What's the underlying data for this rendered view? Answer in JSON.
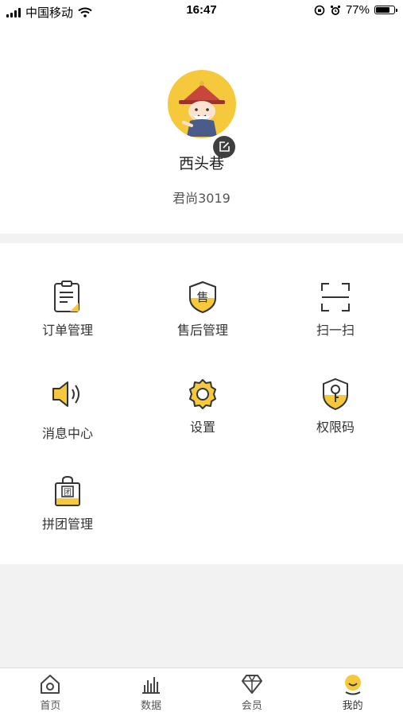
{
  "status_bar": {
    "carrier": "中国移动",
    "time": "16:47",
    "battery": "77%",
    "battery_level": 0.77
  },
  "profile": {
    "name": "西头巷",
    "shop": "君尚3019"
  },
  "menu": {
    "items": [
      {
        "label": "订单管理",
        "icon": "order-icon"
      },
      {
        "label": "售后管理",
        "icon": "after-sales-icon"
      },
      {
        "label": "扫一扫",
        "icon": "scan-icon"
      },
      {
        "label": "消息中心",
        "icon": "speaker-icon"
      },
      {
        "label": "设置",
        "icon": "gear-icon"
      },
      {
        "label": "权限码",
        "icon": "permission-key-icon"
      },
      {
        "label": "拼团管理",
        "icon": "group-buy-bag-icon"
      }
    ]
  },
  "tab_bar": {
    "tabs": [
      {
        "label": "首页",
        "icon": "home-icon"
      },
      {
        "label": "数据",
        "icon": "bar-chart-icon"
      },
      {
        "label": "会员",
        "icon": "diamond-icon"
      },
      {
        "label": "我的",
        "icon": "profile-icon",
        "active": true
      }
    ]
  },
  "colors": {
    "accent": "#f6c93c",
    "stroke": "#333333"
  }
}
